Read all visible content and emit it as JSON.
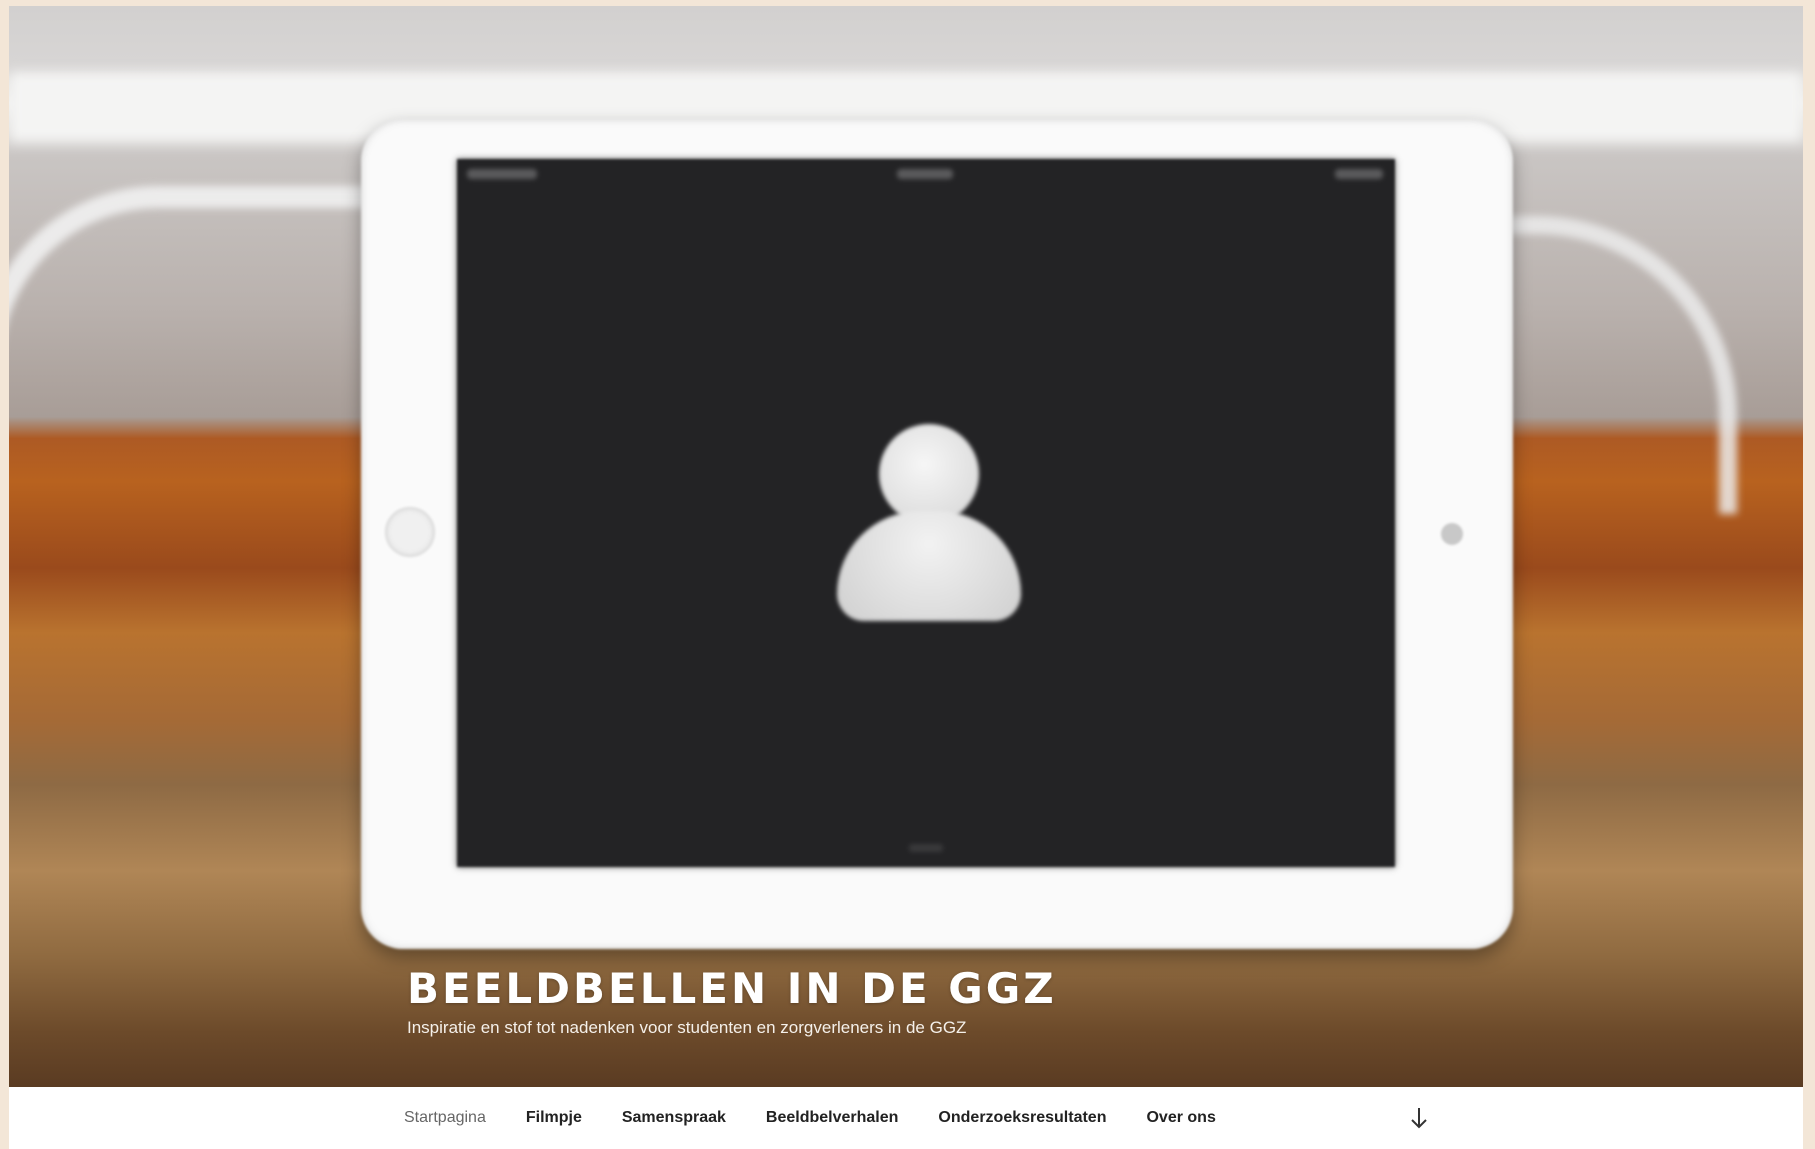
{
  "site": {
    "title": "BEELDBELLEN IN DE GGZ",
    "tagline": "Inspiratie en stof tot nadenken voor studenten en zorgverleners in de GGZ"
  },
  "hero": {
    "image_icon": "tablet-video-call-placeholder",
    "person_icon": "person-silhouette-icon"
  },
  "nav": {
    "items": [
      {
        "label": "Startpagina",
        "current": true
      },
      {
        "label": "Filmpje",
        "current": false
      },
      {
        "label": "Samenspraak",
        "current": false
      },
      {
        "label": "Beeldbelverhalen",
        "current": false
      },
      {
        "label": "Onderzoeksresultaten",
        "current": false
      },
      {
        "label": "Over ons",
        "current": false
      }
    ],
    "scroll_icon": "arrow-down-icon"
  },
  "colors": {
    "nav_text": "#222222",
    "nav_current": "#666666",
    "title_text": "#ffffff"
  }
}
